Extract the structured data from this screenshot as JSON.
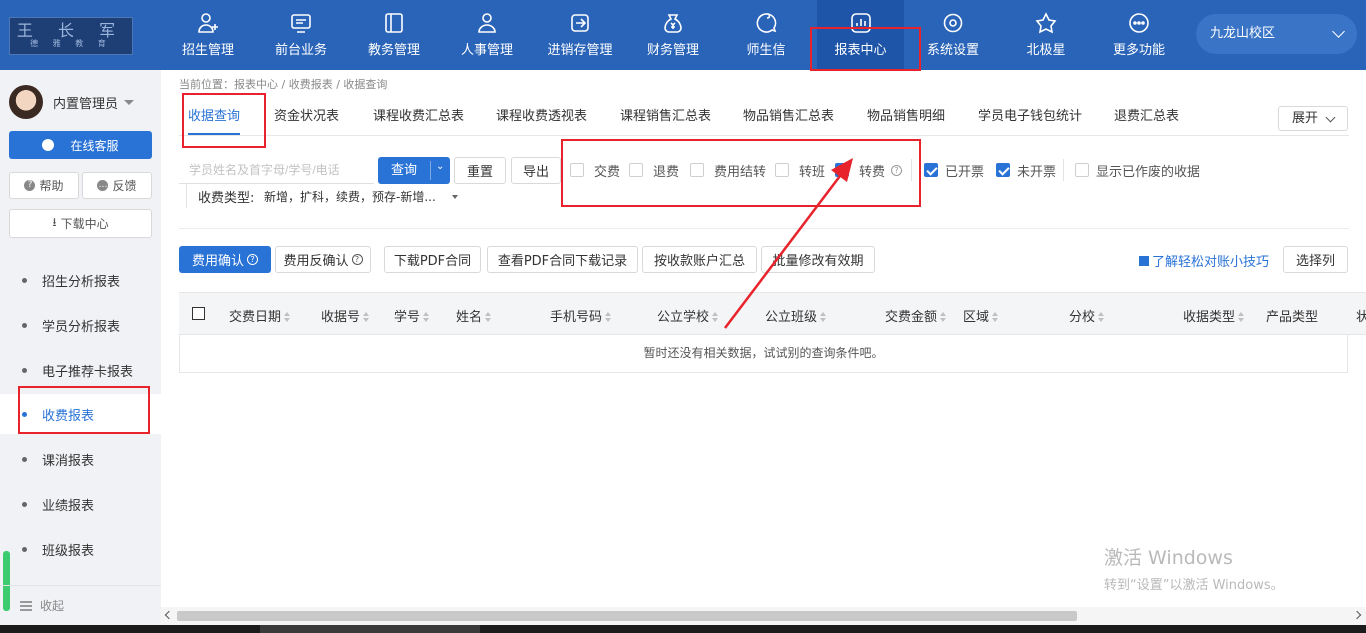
{
  "logo": {
    "line1": "王 长 军",
    "line2": "德 雅 教 育"
  },
  "nav": [
    {
      "label": "招生管理",
      "icon": "person-add-icon"
    },
    {
      "label": "前台业务",
      "icon": "monitor-icon"
    },
    {
      "label": "教务管理",
      "icon": "book-icon"
    },
    {
      "label": "人事管理",
      "icon": "person-icon"
    },
    {
      "label": "进销存管理",
      "icon": "export-icon"
    },
    {
      "label": "财务管理",
      "icon": "money-bag-icon"
    },
    {
      "label": "师生信",
      "icon": "chat-icon"
    },
    {
      "label": "报表中心",
      "icon": "bar-chart-icon",
      "active": true
    },
    {
      "label": "系统设置",
      "icon": "gear-icon"
    },
    {
      "label": "北极星",
      "icon": "star-icon"
    },
    {
      "label": "更多功能",
      "icon": "more-icon"
    }
  ],
  "campus": "九龙山校区",
  "sidebar": {
    "username": "内置管理员",
    "online_service": "在线客服",
    "help": "帮助",
    "feedback": "反馈",
    "download_center": "下载中心",
    "items": [
      {
        "label": "招生分析报表"
      },
      {
        "label": "学员分析报表"
      },
      {
        "label": "电子推荐卡报表"
      },
      {
        "label": "收费报表",
        "active": true
      },
      {
        "label": "课消报表"
      },
      {
        "label": "业绩报表"
      },
      {
        "label": "班级报表"
      }
    ],
    "collapse": "收起"
  },
  "breadcrumb": "当前位置：报表中心 / 收费报表 / 收据查询",
  "tabs": [
    {
      "label": "收据查询",
      "active": true
    },
    {
      "label": "资金状况表"
    },
    {
      "label": "课程收费汇总表"
    },
    {
      "label": "课程收费透视表"
    },
    {
      "label": "课程销售汇总表"
    },
    {
      "label": "物品销售汇总表"
    },
    {
      "label": "物品销售明细"
    },
    {
      "label": "学员电子钱包统计"
    },
    {
      "label": "退费汇总表"
    }
  ],
  "expand_label": "展开",
  "search": {
    "placeholder": "学员姓名及首字母/学号/电话",
    "value": ""
  },
  "buttons": {
    "query": "查询",
    "reset": "重置",
    "export": "导出"
  },
  "filters": [
    {
      "label": "交费",
      "checked": false
    },
    {
      "label": "退费",
      "checked": false
    },
    {
      "label": "费用结转",
      "checked": false
    },
    {
      "label": "转班",
      "checked": false
    },
    {
      "label": "转费",
      "checked": true,
      "help": true
    },
    {
      "label": "已开票",
      "checked": true
    },
    {
      "label": "未开票",
      "checked": true
    },
    {
      "label": "显示已作废的收据",
      "checked": false
    }
  ],
  "receipt_type": {
    "label": "收费类型:",
    "value": "新增，扩科，续费，预存-新增..."
  },
  "actions": {
    "confirm": "费用确认",
    "unconfirm": "费用反确认",
    "download_pdf": "下载PDF合同",
    "pdf_log": "查看PDF合同下载记录",
    "account_summary": "按收款账户汇总",
    "batch_edit": "批量修改有效期",
    "tips": "了解轻松对账小技巧",
    "choose_cols": "选择列"
  },
  "table": {
    "columns": [
      "交费日期",
      "收据号",
      "学号",
      "姓名",
      "手机号码",
      "公立学校",
      "公立班级",
      "交费金额",
      "区域",
      "分校",
      "收据类型",
      "产品类型",
      "状"
    ],
    "empty": "暂时还没有相关数据，试试别的查询条件吧。"
  },
  "watermark": {
    "line1": "激活 Windows",
    "line2": "转到“设置”以激活 Windows。"
  },
  "colors": {
    "nav_bg": "#2a64b8",
    "accent": "#2a73d6",
    "annotation": "#e8232b"
  }
}
